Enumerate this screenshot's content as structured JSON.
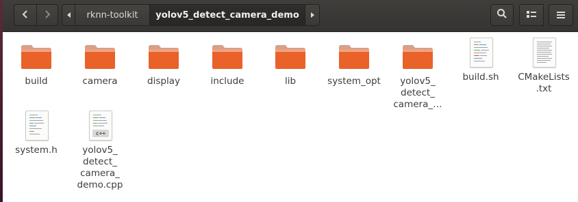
{
  "header": {
    "path": [
      "rknn-toolkit",
      "yolov5_detect_camera_demo"
    ]
  },
  "colors": {
    "header_bg": "#3c3b37",
    "folder_orange": "#e95420",
    "folder_light": "#f6a07a",
    "label_text": "#3c3c3c"
  },
  "files": [
    {
      "name": "build",
      "type": "folder",
      "icon": "folder-icon"
    },
    {
      "name": "camera",
      "type": "folder",
      "icon": "folder-icon"
    },
    {
      "name": "display",
      "type": "folder",
      "icon": "folder-icon"
    },
    {
      "name": "include",
      "type": "folder",
      "icon": "folder-icon"
    },
    {
      "name": "lib",
      "type": "folder",
      "icon": "folder-icon"
    },
    {
      "name": "system_opt",
      "type": "folder",
      "icon": "folder-icon"
    },
    {
      "name": "yolov5_\ndetect_\ncamera_…",
      "type": "folder",
      "icon": "folder-icon"
    },
    {
      "name": "build.sh",
      "type": "script",
      "icon": "script-file-icon"
    },
    {
      "name": "CMakeLists\n.txt",
      "type": "text",
      "icon": "text-file-icon"
    },
    {
      "name": "system.h",
      "type": "header",
      "icon": "header-file-icon"
    },
    {
      "name": "yolov5_\ndetect_\ncamera_\ndemo.cpp",
      "type": "cpp",
      "icon": "cpp-file-icon",
      "tag": "c++"
    }
  ]
}
